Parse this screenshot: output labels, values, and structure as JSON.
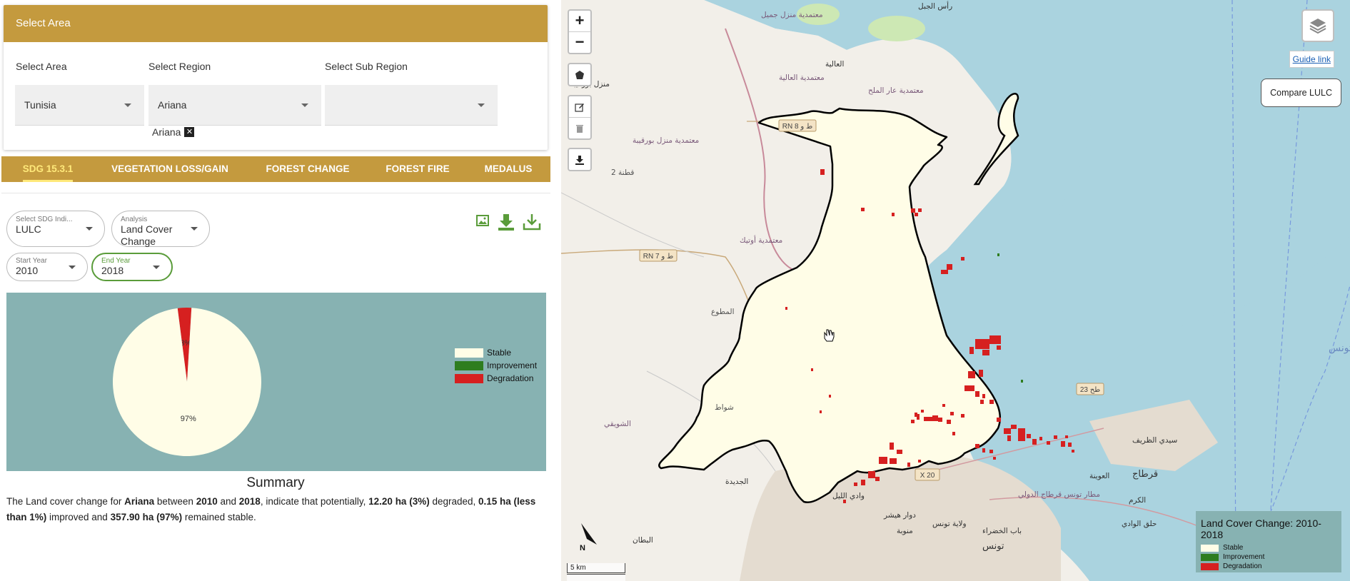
{
  "area_card": {
    "header": "Select Area",
    "labels": {
      "area": "Select Area",
      "region": "Select Region",
      "subregion": "Select Sub Region"
    },
    "values": {
      "area": "Tunisia",
      "region": "Ariana",
      "subregion": ""
    },
    "chip": "Ariana"
  },
  "tabs": [
    "SDG 15.3.1",
    "VEGETATION LOSS/GAIN",
    "FOREST CHANGE",
    "FOREST FIRE",
    "MEDALUS"
  ],
  "controls": {
    "indicator": {
      "label": "Select SDG Indi...",
      "value": "LULC"
    },
    "analysis": {
      "label": "Analysis",
      "value_line1": "Land Cover",
      "value_line2": "Change"
    },
    "start_year": {
      "label": "Start Year",
      "value": "2010"
    },
    "end_year": {
      "label": "End Year",
      "value": "2018"
    }
  },
  "chart_data": {
    "type": "pie",
    "categories": [
      "Stable",
      "Improvement",
      "Degradation"
    ],
    "values": [
      97,
      0,
      3
    ],
    "labels": [
      "97%",
      "",
      "3%"
    ],
    "colors": [
      "#fffde7",
      "#2e7d1f",
      "#d62020"
    ],
    "legend_position": "right"
  },
  "summary": {
    "title": "Summary",
    "p1": "The Land cover change for ",
    "region": "Ariana",
    "p2": " between ",
    "start": "2010",
    "p3": " and ",
    "end": "2018",
    "p4": ", indicate that potentially, ",
    "degraded": "12.20 ha (3%)",
    "p5": " degraded, ",
    "improved": "0.15 ha (less than 1%)",
    "p6": " improved and ",
    "stable": "357.90 ha (97%)",
    "p7": " remained stable."
  },
  "map": {
    "zoom_in": "+",
    "zoom_out": "−",
    "guide_link": "Guide link",
    "compare_button": "Compare LULC",
    "north_label": "N",
    "scale_km": "5 km",
    "place_labels": [
      "رأس الجبل",
      "معتمدية منزل جميل",
      "العالية",
      "معتمدية العالية",
      "منزل بورقيبة",
      "معتمدية عار الملح",
      "RN 8 ط و",
      "معتمدية منزل بورقيبة",
      "قطنة 2",
      "RN 7 ط و",
      "معتمدية أوتيك",
      "المطوع",
      "شواط",
      "الشويقي",
      "الجديدة",
      "وادي الليل",
      "23 طح",
      "سيدي الظريف",
      "قرطاج",
      "الكرم",
      "حلق الوادي",
      "العوينة",
      "مطار تونس قرطاج الدولي",
      "ولاية تونس",
      "تونس",
      "باب الخضراء",
      "منوبة",
      "دوار هيشر",
      "البطان",
      "X 20",
      "تونس"
    ],
    "legend": {
      "title": "Land Cover Change: 2010-2018",
      "items": [
        {
          "label": "Stable",
          "color": "#fffde7"
        },
        {
          "label": "Improvement",
          "color": "#2e7d1f"
        },
        {
          "label": "Degradation",
          "color": "#d62020"
        }
      ]
    }
  }
}
